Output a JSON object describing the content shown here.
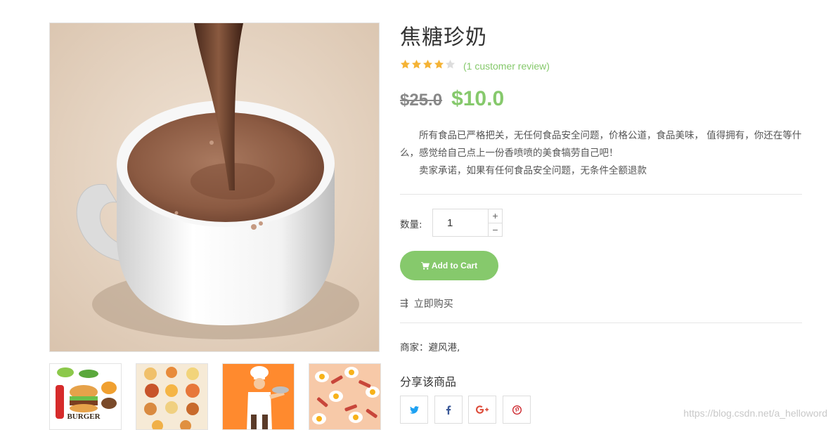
{
  "product": {
    "title": "焦糖珍奶",
    "rating": 4,
    "rating_max": 5,
    "review_link": "(1 customer review)",
    "old_price": "$25.0",
    "new_price": "$10.0",
    "description": [
      "所有食品已严格把关，无任何食品安全问题，价格公道，食品美味， 值得拥有，你还在等什么，感觉给自己点上一份香喷喷的美食犒劳自己吧！",
      "卖家承诺，如果有任何食品安全问题，无条件全额退款"
    ],
    "quantity_label": "数量:",
    "quantity_value": "1",
    "qty_plus": "+",
    "qty_minus": "−",
    "add_to_cart": "Add to Cart",
    "buy_now_icon": "⇶",
    "buy_now": "立即购买",
    "merchant": "商家：避风港,",
    "share_title": "分享该商品"
  },
  "thumbnails": [
    {
      "name": "burger-illustration",
      "label": "BURGER"
    },
    {
      "name": "food-dishes-illustration"
    },
    {
      "name": "chef-illustration"
    },
    {
      "name": "egg-bacon-pattern"
    }
  ],
  "share": [
    {
      "name": "twitter-icon",
      "icon": "twitter"
    },
    {
      "name": "facebook-icon",
      "icon": "facebook"
    },
    {
      "name": "google-plus-icon",
      "icon": "google-plus"
    },
    {
      "name": "pinterest-icon",
      "icon": "pinterest"
    }
  ],
  "watermark": "https://blog.csdn.net/a_helloword",
  "colors": {
    "accent": "#86c96c",
    "star": "#f5b335",
    "star_empty": "#dddddd",
    "twitter": "#1da1f2",
    "facebook": "#3b5998",
    "google": "#dd4b39",
    "pinterest": "#cb2027"
  }
}
